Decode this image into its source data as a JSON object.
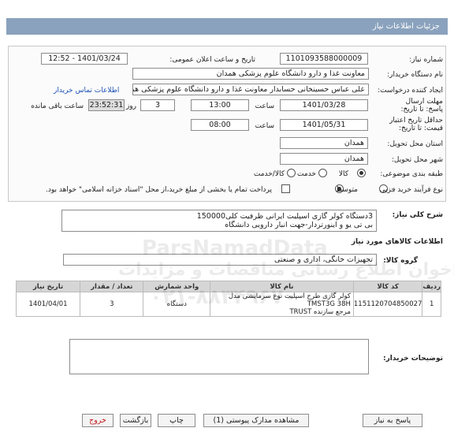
{
  "header": {
    "title": "جزئیات اطلاعات نیاز"
  },
  "fields": {
    "need_number_label": "شماره نیاز:",
    "need_number": "1101093588000009",
    "announce_label": "تاریخ و ساعت اعلان عمومی:",
    "announce_value": "1401/03/24 - 12:52",
    "buyer_label": "نام دستگاه خریدار:",
    "buyer_value": "معاونت غذا و دارو دانشگاه علوم پزشکی همدان",
    "creator_label": "ایجاد کننده درخواست:",
    "creator_value": "علی عباس  حسینخانی حسابدار معاونت غذا و دارو دانشگاه علوم پزشکی همدان",
    "contact_link": "اطلاعات تماس خریدار",
    "deadline_label": "مهلت ارسال پاسخ: تا تاریخ:",
    "deadline_date": "1401/03/28",
    "time_label": "ساعت",
    "deadline_time": "13:00",
    "days_value": "3",
    "days_label": "روز و",
    "remaining_value": "23:52:31",
    "remaining_label": "ساعت باقی مانده",
    "validity_label": "حداقل تاریخ اعتبار قیمت: تا تاریخ:",
    "validity_date": "1401/05/31",
    "validity_time": "08:00",
    "province_label": "استان محل تحویل:",
    "province_value": "همدان",
    "city_label": "شهر محل تحویل:",
    "city_value": "همدان",
    "category_label": "طبقه بندی موضوعی:",
    "category_options": [
      "کالا",
      "خدمت",
      "کالا/خدمت"
    ],
    "process_label": "نوع فرآیند خرید :",
    "process_options": [
      "جزیی",
      "متوسط"
    ],
    "payment_text": "پرداخت تمام یا بخشی از مبلغ خرید،از محل \"اسناد خزانه اسلامی\" خواهد بود."
  },
  "description": {
    "label": "شرح کلی نیاز:",
    "line1": "3دستگاه کولر گازی اسپلیت ایرانی ظرفیت کلی150000",
    "line2": "بی تی یو و اینورتردار-جهت انبار دارویی دانشگاه"
  },
  "goods_section": {
    "title": "اطلاعات کالاهای مورد نیاز"
  },
  "group": {
    "label": "گروه کالا:",
    "value": "تجهیزات خانگی، اداری و صنعتی"
  },
  "table": {
    "headers": [
      "ردیف",
      "کد کالا",
      "نام کالا",
      "واحد شمارش",
      "تعداد / مقدار",
      "تاریخ نیاز"
    ],
    "rows": [
      {
        "row": "1",
        "code": "1151120704850027",
        "name_line1": "کولر گازی طرح اسپلیت نوع سرمایشی مدل TMST3G 38H",
        "name_line2": "مرجع سازنده TRUST",
        "unit": "دستگاه",
        "qty": "3",
        "date": "1401/04/01"
      }
    ]
  },
  "buyer_notes": {
    "label": "توضیحات خریدار:",
    "value": ""
  },
  "buttons": {
    "reply": "پاسخ به نیاز",
    "attachments": "مشاهده مدارک پیوستی (1)",
    "print": "چاپ",
    "back": "بازگشت",
    "exit": "خروج"
  },
  "watermark": {
    "brand": "ParsNamadData",
    "fa": "مرکز فراخوان اطلاع رسانی مناقصات و مزایدات",
    "phone": "۰۲۱-۸۸۳۴۹۶۷۰"
  }
}
